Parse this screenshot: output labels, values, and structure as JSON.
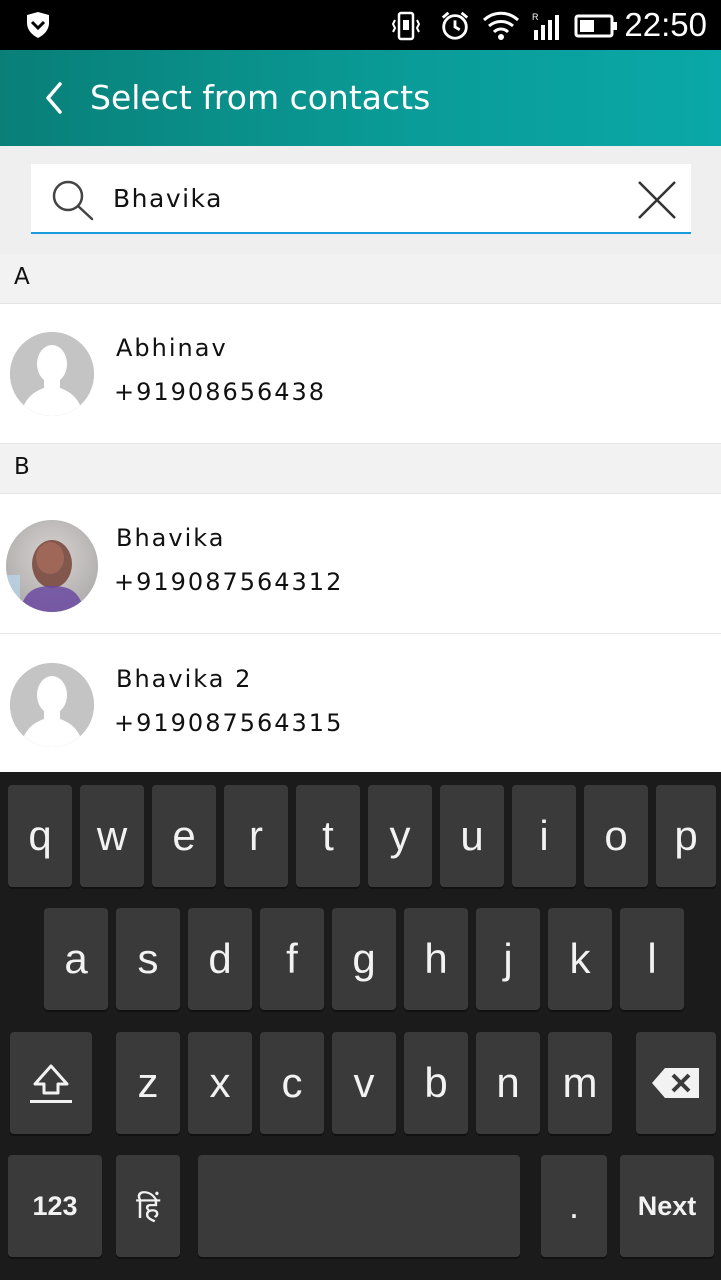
{
  "status_bar": {
    "time": "22:50",
    "icons": [
      "shield-icon",
      "vibrate-icon",
      "alarm-icon",
      "wifi-icon",
      "signal-icon",
      "battery-icon"
    ]
  },
  "app_bar": {
    "title": "Select from contacts",
    "back_icon": "chevron-left-icon"
  },
  "search": {
    "value": "Bhavika",
    "search_icon": "search-icon",
    "clear_icon": "close-icon",
    "accent": "#1a9bdb"
  },
  "contacts": {
    "sections": [
      {
        "letter": "A",
        "items": [
          {
            "name": "Abhinav",
            "phone": "+91908656438",
            "avatar": "default-avatar-icon"
          }
        ]
      },
      {
        "letter": "B",
        "items": [
          {
            "name": "Bhavika",
            "phone": "+919087564312",
            "avatar": "photo-avatar"
          },
          {
            "name": "Bhavika 2",
            "phone": "+919087564315",
            "avatar": "default-avatar-icon"
          }
        ]
      }
    ]
  },
  "keyboard": {
    "row1": [
      "q",
      "w",
      "e",
      "r",
      "t",
      "y",
      "u",
      "i",
      "o",
      "p"
    ],
    "row2": [
      "a",
      "s",
      "d",
      "f",
      "g",
      "h",
      "j",
      "k",
      "l"
    ],
    "row3": [
      "z",
      "x",
      "c",
      "v",
      "b",
      "n",
      "m"
    ],
    "shift_icon": "shift-icon",
    "backspace_icon": "backspace-icon",
    "numbers_label": "123",
    "language_label": "हिं",
    "period_label": ".",
    "next_label": "Next"
  },
  "colors": {
    "app_bar_start": "#097f78",
    "app_bar_end": "#0aa8a8",
    "keyboard_bg": "#1b1b1b",
    "key_bg": "#3a3a3a"
  }
}
